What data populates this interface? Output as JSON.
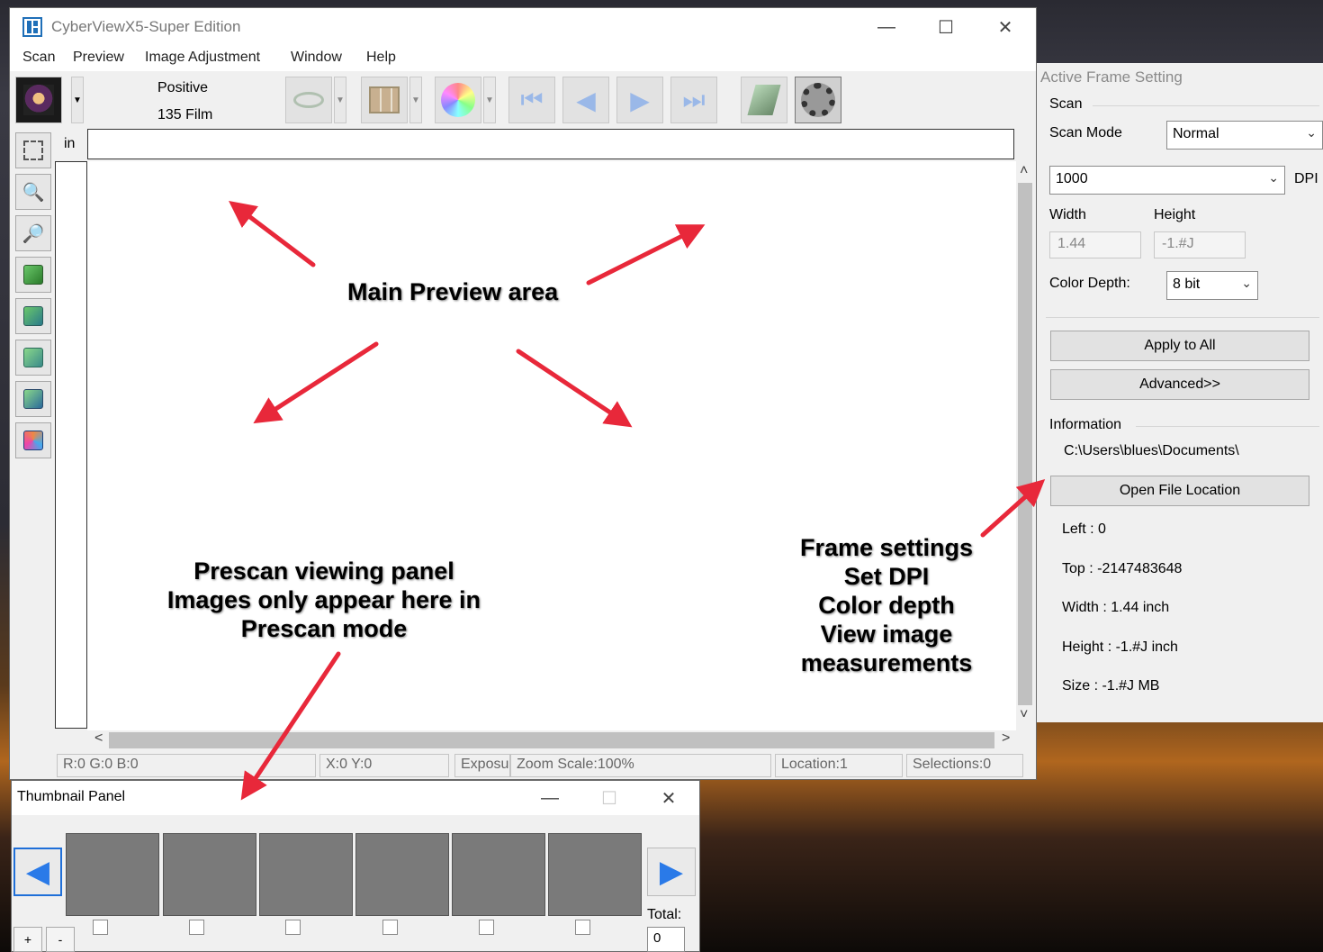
{
  "app": {
    "title": "CyberViewX5-Super Edition",
    "controls": {
      "minimize": "—",
      "maximize": "☐",
      "close": "✕"
    }
  },
  "menu": [
    "Scan",
    "Preview",
    "Image Adjustment",
    "Window",
    "Help"
  ],
  "toolbar": {
    "film_mode": "Positive",
    "film_type": "135 Film",
    "icons": [
      "film-source-icon",
      "eye-icon",
      "filmstrip-icon",
      "color-wheel-icon",
      "skip-back-icon",
      "back-icon",
      "forward-icon",
      "skip-forward-icon",
      "scan-icon",
      "settings-gear-icon"
    ]
  },
  "ruler": {
    "unit": "in"
  },
  "side_tools": [
    "select-frame-icon",
    "zoom-in-icon",
    "zoom-out-icon",
    "rotate-left-icon",
    "rotate-right-icon",
    "flip-horizontal-icon",
    "flip-vertical-icon",
    "reset-icon"
  ],
  "status": {
    "rgb": "R:0 G:0 B:0",
    "xy": "X:0 Y:0",
    "exposure": "Exposu",
    "zoom": "Zoom Scale:100%",
    "location": "Location:1",
    "selections": "Selections:0"
  },
  "frame_panel": {
    "title": "Active Frame Setting",
    "scan_group": "Scan",
    "scan_mode_label": "Scan Mode",
    "scan_mode_value": "Normal",
    "dpi_value": "1000",
    "dpi_label": "DPI",
    "width_label": "Width",
    "height_label": "Height",
    "width_value": "1.44",
    "height_value": "-1.#J",
    "color_depth_label": "Color Depth:",
    "color_depth_value": "8 bit",
    "apply_all": "Apply to All",
    "advanced": "Advanced>>",
    "info_group": "Information",
    "path": "C:\\Users\\blues\\Documents\\",
    "open_location": "Open File Location",
    "left": "Left : 0",
    "top": "Top : -2147483648",
    "width_info": "Width : 1.44 inch",
    "height_info": "Height : -1.#J inch",
    "size_info": "Size : -1.#J MB"
  },
  "thumb_panel": {
    "title": "Thumbnail Panel",
    "total_label": "Total:",
    "total_value": "0",
    "add": "+",
    "remove": "-",
    "slots": 6
  },
  "annotations": {
    "preview": "Main Preview area",
    "prescan_1": "Prescan viewing panel",
    "prescan_2": "Images only appear here in",
    "prescan_3": "Prescan mode",
    "frame_1": "Frame settings",
    "frame_2": "Set DPI",
    "frame_3": "Color depth",
    "frame_4": "View image",
    "frame_5": "measurements"
  },
  "colors": {
    "arrow": "#e8283a",
    "thumb_slot": "#7a7a7a",
    "nav_blue": "#1f6fd8"
  }
}
